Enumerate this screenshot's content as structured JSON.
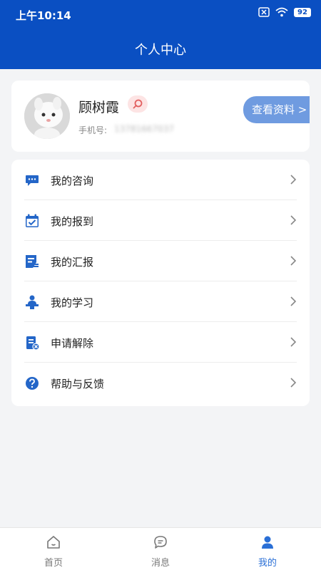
{
  "status_bar": {
    "time": "上午10:14",
    "battery": "92"
  },
  "header": {
    "title": "个人中心"
  },
  "profile": {
    "name": "顾树霞",
    "phone_label": "手机号:",
    "phone_value": "13781667037",
    "view_button": "查看资料 >"
  },
  "menu": {
    "items": [
      {
        "label": "我的咨询",
        "icon": "chat-bubble-icon"
      },
      {
        "label": "我的报到",
        "icon": "calendar-check-icon"
      },
      {
        "label": "我的汇报",
        "icon": "report-icon"
      },
      {
        "label": "我的学习",
        "icon": "lecturer-icon"
      },
      {
        "label": "申请解除",
        "icon": "document-cancel-icon"
      },
      {
        "label": "帮助与反馈",
        "icon": "help-icon"
      }
    ]
  },
  "tabbar": {
    "tabs": [
      {
        "label": "首页",
        "icon": "home-icon",
        "active": false
      },
      {
        "label": "消息",
        "icon": "message-icon",
        "active": false
      },
      {
        "label": "我的",
        "icon": "user-icon",
        "active": true
      }
    ]
  },
  "colors": {
    "primary": "#0a4fc2",
    "button": "#6f9be0",
    "active_tab": "#2a6fd6",
    "icon": "#2466c8",
    "background": "#f3f4f6"
  }
}
